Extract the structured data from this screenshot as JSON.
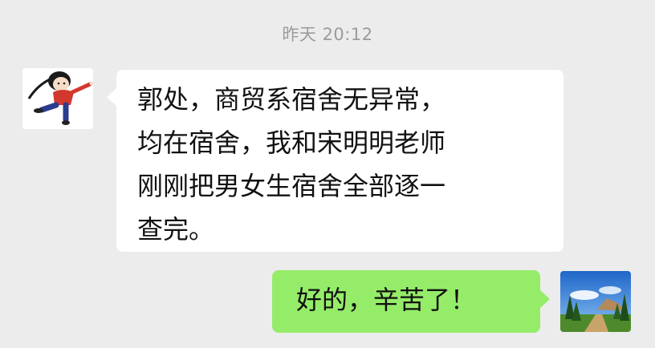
{
  "chat": {
    "timestamp": "昨天 20:12",
    "messages": [
      {
        "direction": "incoming",
        "avatar_icon": "cartoon-child-kicking-avatar",
        "lines": [
          "郭处，商贸系宿舍无异常，",
          "均在宿舍，我和宋明明老师",
          "刚刚把男女生宿舍全部逐一",
          "查完。"
        ]
      },
      {
        "direction": "outgoing",
        "avatar_icon": "landscape-photo-avatar",
        "text": "好的，辛苦了！"
      }
    ]
  },
  "colors": {
    "background": "#ececec",
    "incoming_bubble": "#ffffff",
    "outgoing_bubble": "#95ec69",
    "timestamp_text": "#9b9b9b"
  }
}
